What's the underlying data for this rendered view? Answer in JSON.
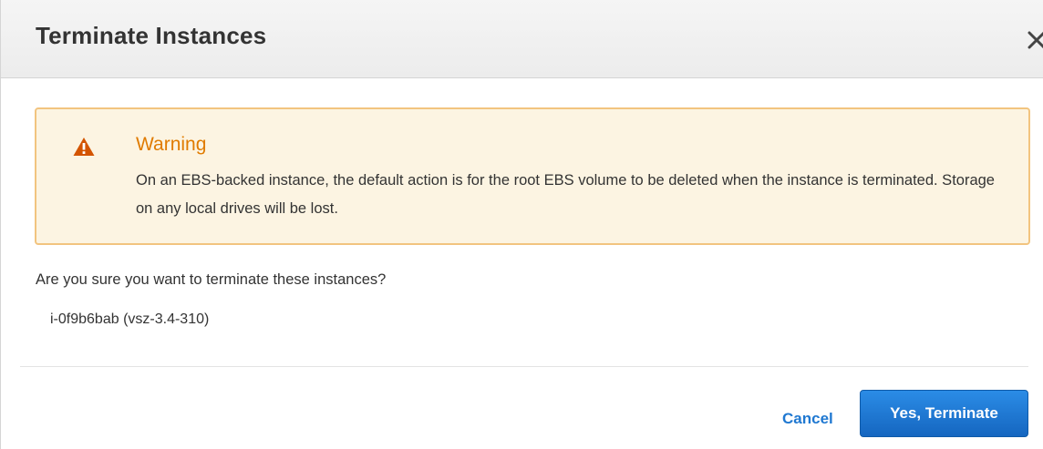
{
  "dialog": {
    "title": "Terminate Instances",
    "close_icon": "close-icon"
  },
  "warning": {
    "icon": "warning-triangle-icon",
    "title": "Warning",
    "message": "On an EBS-backed instance, the default action is for the root EBS volume to be deleted when the instance is terminated. Storage on any local drives will be lost.",
    "colors": {
      "title": "#e07b00",
      "background": "#fcf4e2",
      "border": "#f2c47f"
    }
  },
  "confirm": {
    "question": "Are you sure you want to terminate these instances?",
    "instances": [
      "i-0f9b6bab (vsz-3.4-310)"
    ]
  },
  "footer": {
    "cancel_label": "Cancel",
    "confirm_label": "Yes, Terminate",
    "accent": "#1f78d1"
  }
}
